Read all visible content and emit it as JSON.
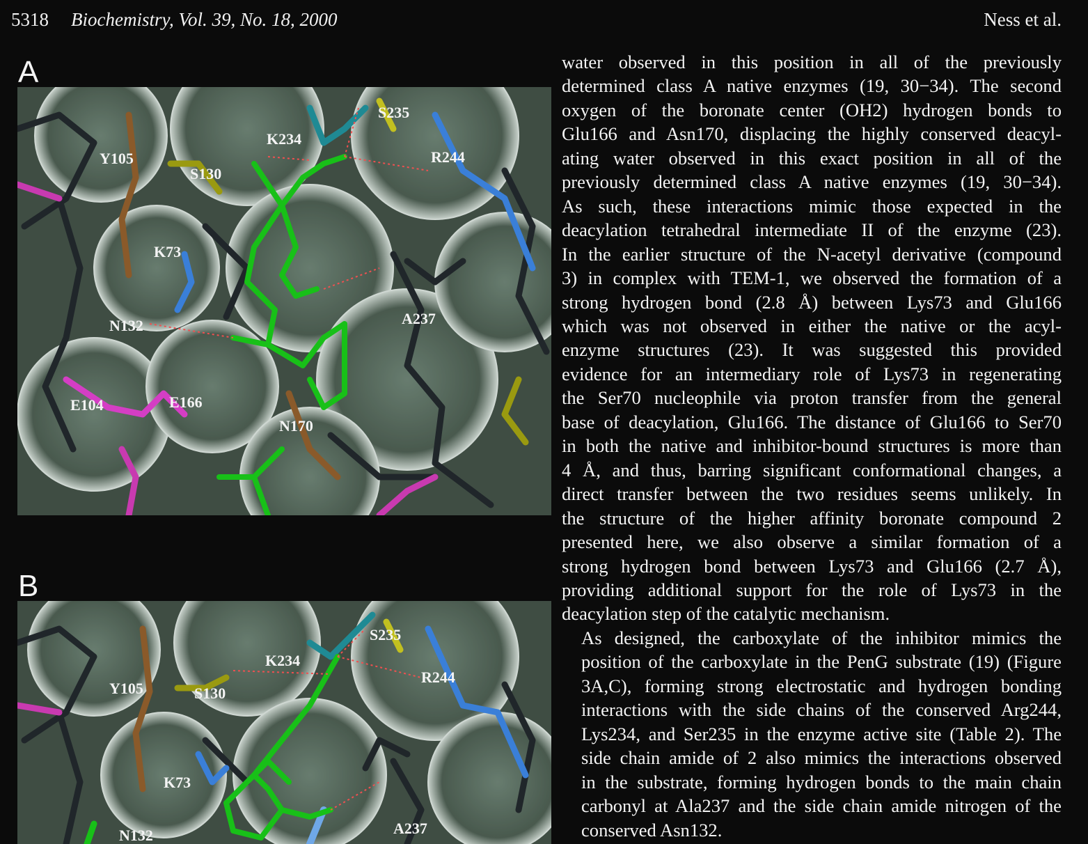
{
  "header": {
    "page_number": "5318",
    "journal": "Biochemistry, Vol. 39, No. 18, 2000",
    "authors": "Ness et al."
  },
  "figure": {
    "panel_a": {
      "letter": "A",
      "residues": {
        "y105": "Y105",
        "s130": "S130",
        "k234": "K234",
        "s235": "S235",
        "r244": "R244",
        "k73": "K73",
        "n132": "N132",
        "a237": "A237",
        "e104": "E104",
        "e166": "E166",
        "n170": "N170"
      }
    },
    "panel_b": {
      "letter": "B",
      "residues": {
        "y105": "Y105",
        "s130": "S130",
        "k234": "K234",
        "s235": "S235",
        "r244": "R244",
        "k73": "K73",
        "n132": "N132",
        "a237": "A237"
      }
    }
  },
  "text": {
    "p1": [
      "water observed in this position in all of the previously",
      "determined class A native enzymes (19, 30−34). The second",
      "oxygen of the boronate center (OH2) hydrogen bonds to",
      "Glu166 and Asn170, displacing the highly conserved deacyl-",
      "ating water observed in this exact position in all of the",
      "previously determined class A native enzymes (19, 30−34).",
      "As such, these interactions mimic those expected in the",
      "deacylation tetrahedral intermediate II of the enzyme (23).",
      "In the earlier structure of the N-acetyl derivative (compound",
      "3) in complex with TEM-1, we observed the formation of a",
      "strong hydrogen bond (2.8 Å) between Lys73 and Glu166",
      "which was not observed in either the native or the acyl-",
      "enzyme structures (23). It was suggested this provided",
      "evidence for an intermediary role of Lys73 in regenerating",
      "the Ser70 nucleophile via proton transfer from the general",
      "base of deacylation, Glu166. The distance of Glu166 to Ser70",
      "in both the native and inhibitor-bound structures is more than",
      "4 Å, and thus, barring significant conformational changes, a",
      "direct transfer between the two residues seems unlikely. In",
      "the structure of the higher affinity boronate compound 2",
      "presented here, we also observe a similar formation of a",
      "strong hydrogen bond between Lys73 and Glu166 (2.7 Å),",
      "providing additional support for the role of Lys73 in the",
      "deacylation step of the catalytic mechanism."
    ],
    "p2": [
      "As designed, the carboxylate of the inhibitor mimics the",
      "position of the carboxylate in the PenG substrate (19) (Figure",
      "3A,C), forming strong electrostatic and hydrogen bonding",
      "interactions with the side chains of the conserved Arg244,",
      "Lys234, and Ser235 in the enzyme active site (Table 2). The",
      "side chain amide of 2 also mimics the interactions observed",
      "in the substrate, forming hydrogen bonds to the main chain",
      "carbonyl at Ala237 and the side chain amide nitrogen of the",
      "conserved Asn132."
    ]
  }
}
